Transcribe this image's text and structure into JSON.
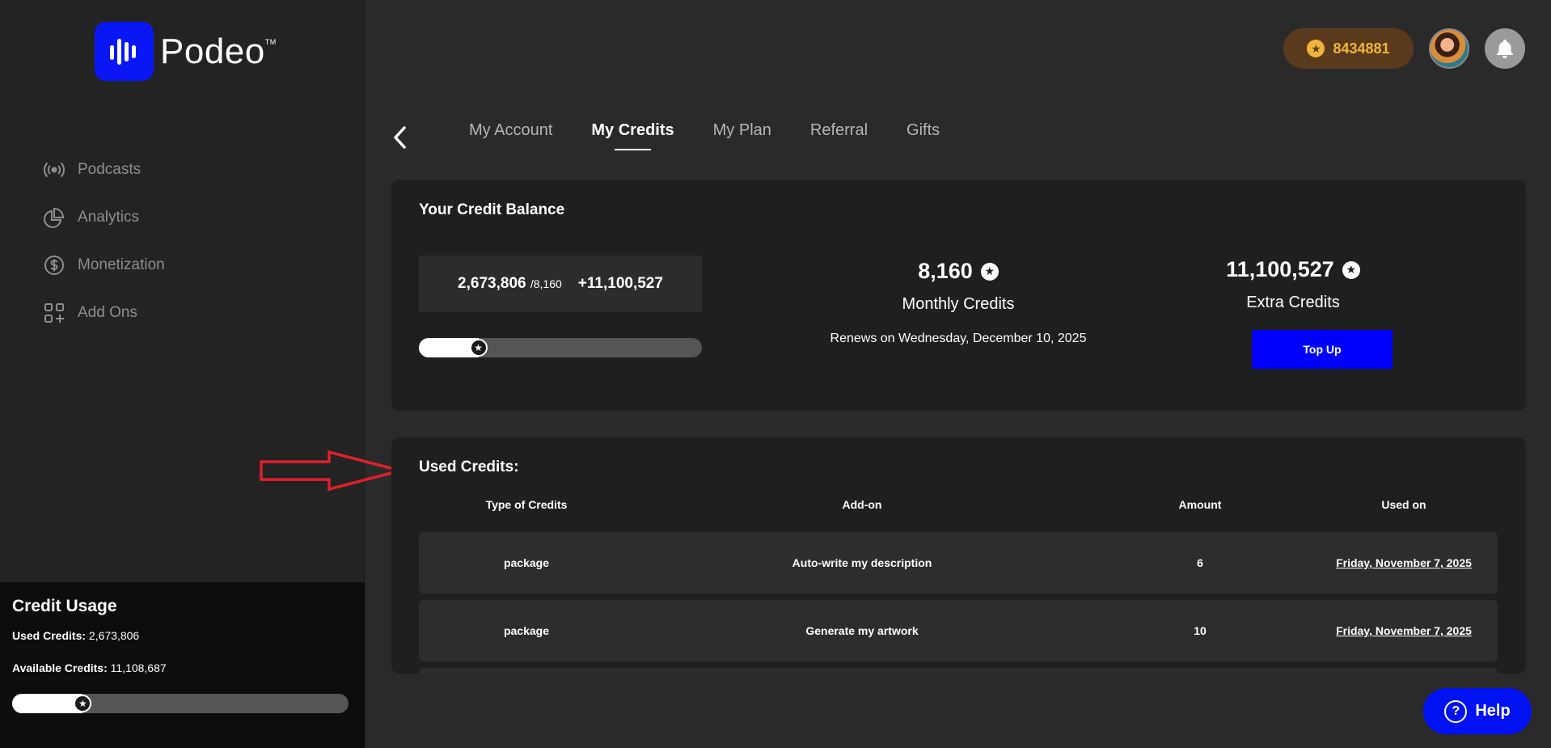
{
  "brand": {
    "name": "Podeo",
    "trademark": "TM"
  },
  "sidebar": {
    "items": [
      {
        "label": "Podcasts",
        "icon": "podcast-icon"
      },
      {
        "label": "Analytics",
        "icon": "analytics-icon"
      },
      {
        "label": "Monetization",
        "icon": "dollar-icon"
      },
      {
        "label": "Add Ons",
        "icon": "add-ons-icon"
      }
    ],
    "credit_usage": {
      "title": "Credit Usage",
      "used_label": "Used Credits:",
      "used_value": "2,673,806",
      "available_label": "Available Credits:",
      "available_value": "11,108,687",
      "progress": 0.21
    }
  },
  "header": {
    "coins": "8434881",
    "colors": {
      "coin_bg": "#5a3a1c",
      "coin_text": "#f0b43a"
    }
  },
  "tabs": [
    {
      "label": "My Account",
      "active": false
    },
    {
      "label": "My Credits",
      "active": true
    },
    {
      "label": "My Plan",
      "active": false
    },
    {
      "label": "Referral",
      "active": false
    },
    {
      "label": "Gifts",
      "active": false
    }
  ],
  "balance": {
    "title": "Your Credit Balance",
    "used": "2,673,806",
    "monthly_total": "/8,160",
    "extra_added": "+11,100,527",
    "progress": 0.21,
    "monthly": {
      "value": "8,160",
      "label": "Monthly Credits",
      "renews": "Renews on Wednesday, December 10, 2025"
    },
    "extra": {
      "value": "11,100,527",
      "label": "Extra Credits",
      "button": "Top Up"
    }
  },
  "used_credits": {
    "title": "Used Credits:",
    "columns": [
      "Type of Credits",
      "Add-on",
      "Amount",
      "Used on"
    ],
    "rows": [
      {
        "type": "package",
        "addon": "Auto-write my description",
        "amount": "6",
        "used_on": "Friday, November 7, 2025"
      },
      {
        "type": "package",
        "addon": "Generate my artwork",
        "amount": "10",
        "used_on": "Friday, November 7, 2025"
      }
    ]
  },
  "help": {
    "label": "Help"
  },
  "colors": {
    "accent": "#0000ff",
    "arrow": "#e0202a"
  }
}
